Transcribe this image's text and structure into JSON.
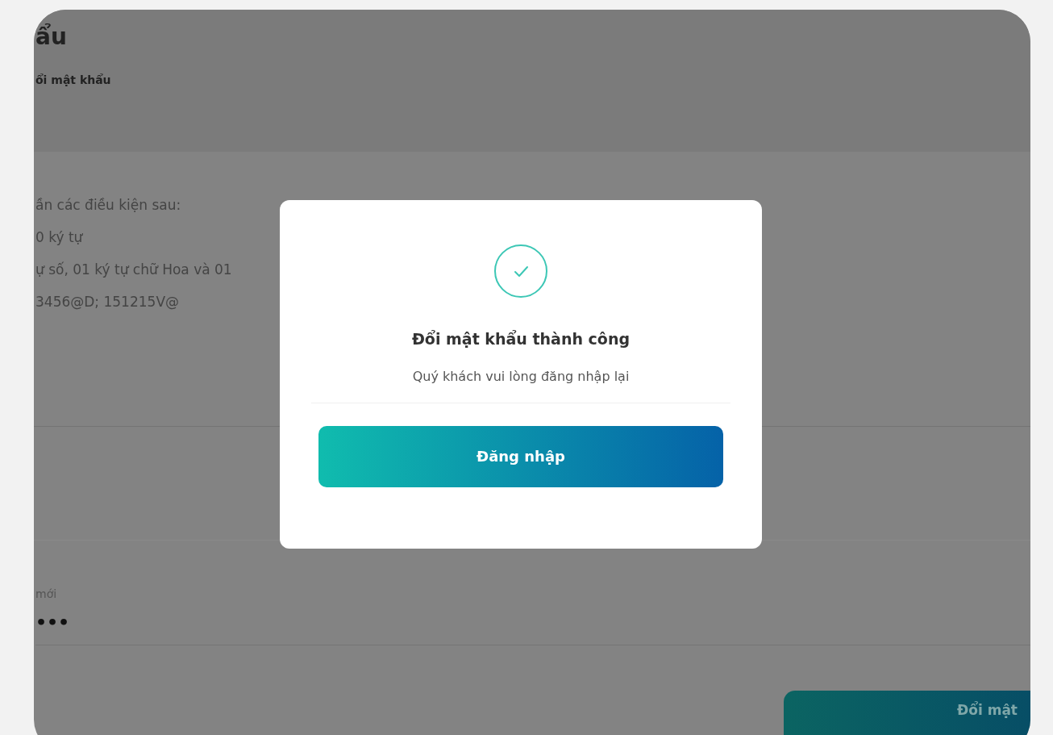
{
  "page": {
    "title": "ẩu",
    "subtitle": "ổi mật khẩu",
    "conditions": [
      "ần các điều kiện sau:",
      "0 ký tự",
      "ự số, 01 ký tự chữ Hoa và 01",
      "3456@D; 151215V@"
    ],
    "new_password": {
      "label": "mới",
      "value": "•••"
    },
    "submit_button": "Đổi mật"
  },
  "dialog": {
    "title": "Đổi mật khẩu thành công",
    "message": "Quý khách vui lòng đăng nhập lại",
    "button": "Đăng nhập"
  }
}
